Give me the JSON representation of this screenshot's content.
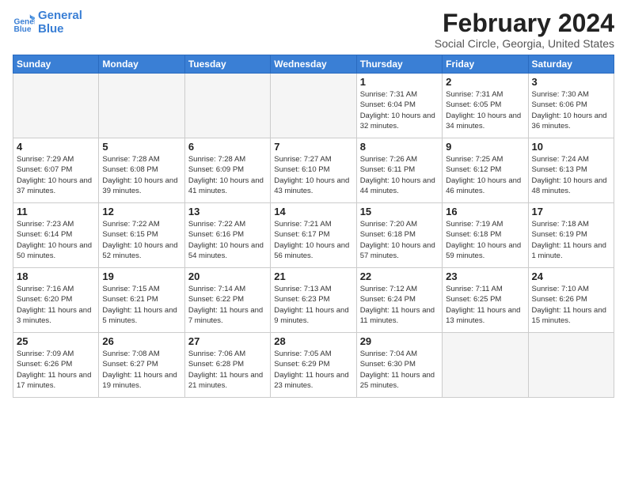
{
  "header": {
    "logo_line1": "General",
    "logo_line2": "Blue",
    "month_title": "February 2024",
    "location": "Social Circle, Georgia, United States"
  },
  "weekdays": [
    "Sunday",
    "Monday",
    "Tuesday",
    "Wednesday",
    "Thursday",
    "Friday",
    "Saturday"
  ],
  "weeks": [
    [
      {
        "day": "",
        "empty": true
      },
      {
        "day": "",
        "empty": true
      },
      {
        "day": "",
        "empty": true
      },
      {
        "day": "",
        "empty": true
      },
      {
        "day": "1",
        "sunrise": "7:31 AM",
        "sunset": "6:04 PM",
        "daylight": "10 hours and 32 minutes."
      },
      {
        "day": "2",
        "sunrise": "7:31 AM",
        "sunset": "6:05 PM",
        "daylight": "10 hours and 34 minutes."
      },
      {
        "day": "3",
        "sunrise": "7:30 AM",
        "sunset": "6:06 PM",
        "daylight": "10 hours and 36 minutes."
      }
    ],
    [
      {
        "day": "4",
        "sunrise": "7:29 AM",
        "sunset": "6:07 PM",
        "daylight": "10 hours and 37 minutes."
      },
      {
        "day": "5",
        "sunrise": "7:28 AM",
        "sunset": "6:08 PM",
        "daylight": "10 hours and 39 minutes."
      },
      {
        "day": "6",
        "sunrise": "7:28 AM",
        "sunset": "6:09 PM",
        "daylight": "10 hours and 41 minutes."
      },
      {
        "day": "7",
        "sunrise": "7:27 AM",
        "sunset": "6:10 PM",
        "daylight": "10 hours and 43 minutes."
      },
      {
        "day": "8",
        "sunrise": "7:26 AM",
        "sunset": "6:11 PM",
        "daylight": "10 hours and 44 minutes."
      },
      {
        "day": "9",
        "sunrise": "7:25 AM",
        "sunset": "6:12 PM",
        "daylight": "10 hours and 46 minutes."
      },
      {
        "day": "10",
        "sunrise": "7:24 AM",
        "sunset": "6:13 PM",
        "daylight": "10 hours and 48 minutes."
      }
    ],
    [
      {
        "day": "11",
        "sunrise": "7:23 AM",
        "sunset": "6:14 PM",
        "daylight": "10 hours and 50 minutes."
      },
      {
        "day": "12",
        "sunrise": "7:22 AM",
        "sunset": "6:15 PM",
        "daylight": "10 hours and 52 minutes."
      },
      {
        "day": "13",
        "sunrise": "7:22 AM",
        "sunset": "6:16 PM",
        "daylight": "10 hours and 54 minutes."
      },
      {
        "day": "14",
        "sunrise": "7:21 AM",
        "sunset": "6:17 PM",
        "daylight": "10 hours and 56 minutes."
      },
      {
        "day": "15",
        "sunrise": "7:20 AM",
        "sunset": "6:18 PM",
        "daylight": "10 hours and 57 minutes."
      },
      {
        "day": "16",
        "sunrise": "7:19 AM",
        "sunset": "6:18 PM",
        "daylight": "10 hours and 59 minutes."
      },
      {
        "day": "17",
        "sunrise": "7:18 AM",
        "sunset": "6:19 PM",
        "daylight": "11 hours and 1 minute."
      }
    ],
    [
      {
        "day": "18",
        "sunrise": "7:16 AM",
        "sunset": "6:20 PM",
        "daylight": "11 hours and 3 minutes."
      },
      {
        "day": "19",
        "sunrise": "7:15 AM",
        "sunset": "6:21 PM",
        "daylight": "11 hours and 5 minutes."
      },
      {
        "day": "20",
        "sunrise": "7:14 AM",
        "sunset": "6:22 PM",
        "daylight": "11 hours and 7 minutes."
      },
      {
        "day": "21",
        "sunrise": "7:13 AM",
        "sunset": "6:23 PM",
        "daylight": "11 hours and 9 minutes."
      },
      {
        "day": "22",
        "sunrise": "7:12 AM",
        "sunset": "6:24 PM",
        "daylight": "11 hours and 11 minutes."
      },
      {
        "day": "23",
        "sunrise": "7:11 AM",
        "sunset": "6:25 PM",
        "daylight": "11 hours and 13 minutes."
      },
      {
        "day": "24",
        "sunrise": "7:10 AM",
        "sunset": "6:26 PM",
        "daylight": "11 hours and 15 minutes."
      }
    ],
    [
      {
        "day": "25",
        "sunrise": "7:09 AM",
        "sunset": "6:26 PM",
        "daylight": "11 hours and 17 minutes."
      },
      {
        "day": "26",
        "sunrise": "7:08 AM",
        "sunset": "6:27 PM",
        "daylight": "11 hours and 19 minutes."
      },
      {
        "day": "27",
        "sunrise": "7:06 AM",
        "sunset": "6:28 PM",
        "daylight": "11 hours and 21 minutes."
      },
      {
        "day": "28",
        "sunrise": "7:05 AM",
        "sunset": "6:29 PM",
        "daylight": "11 hours and 23 minutes."
      },
      {
        "day": "29",
        "sunrise": "7:04 AM",
        "sunset": "6:30 PM",
        "daylight": "11 hours and 25 minutes."
      },
      {
        "day": "",
        "empty": true
      },
      {
        "day": "",
        "empty": true
      }
    ]
  ]
}
